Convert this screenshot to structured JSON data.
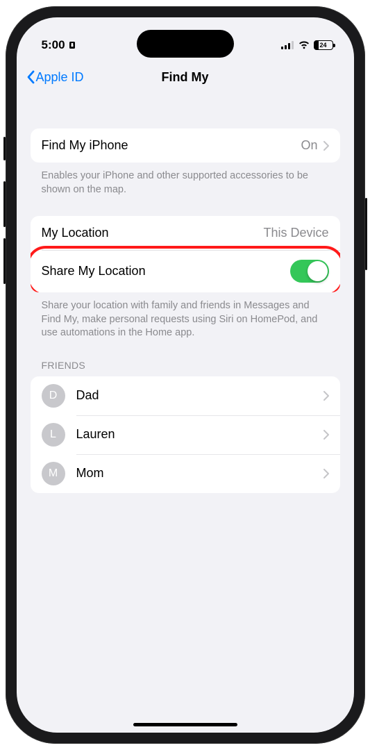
{
  "statusbar": {
    "time": "5:00",
    "battery": "24"
  },
  "nav": {
    "back_label": "Apple ID",
    "title": "Find My"
  },
  "findmy": {
    "label": "Find My iPhone",
    "value": "On",
    "footer": "Enables your iPhone and other supported accessories to be shown on the map."
  },
  "location": {
    "mylocation_label": "My Location",
    "mylocation_value": "This Device",
    "share_label": "Share My Location",
    "share_on": true,
    "footer": "Share your location with family and friends in Messages and Find My, make personal requests using Siri on HomePod, and use automations in the Home app."
  },
  "friends_header": "FRIENDS",
  "friends": [
    {
      "initial": "D",
      "name": "Dad"
    },
    {
      "initial": "L",
      "name": "Lauren"
    },
    {
      "initial": "M",
      "name": "Mom"
    }
  ]
}
